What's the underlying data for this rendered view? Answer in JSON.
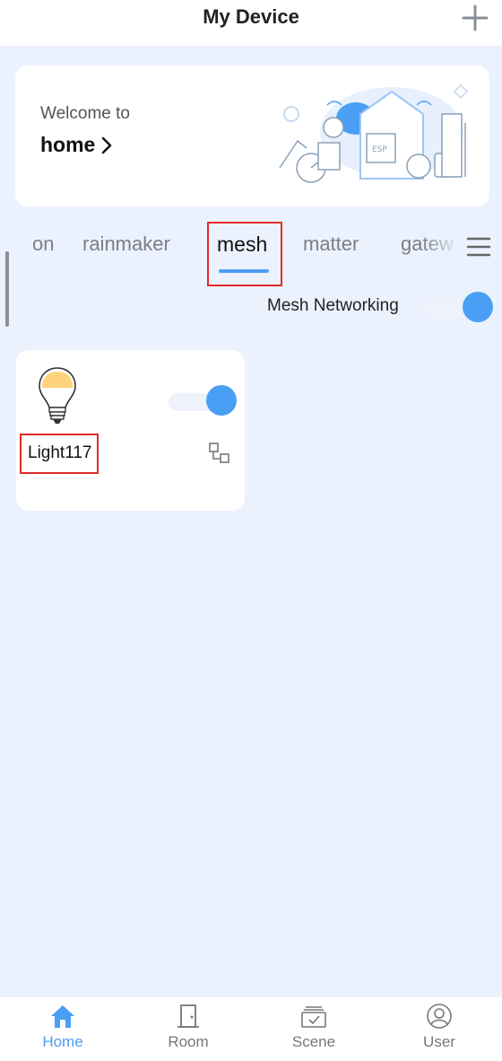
{
  "header": {
    "title": "My Device",
    "add_icon": "plus-icon"
  },
  "welcome": {
    "greeting": "Welcome to",
    "home_name": "home",
    "chevron_icon": "chevron-right-icon",
    "illustration": "smart-home-illustration"
  },
  "tabs": {
    "items": [
      {
        "label": "on"
      },
      {
        "label": "rainmaker"
      },
      {
        "label": "mesh"
      },
      {
        "label": "matter"
      },
      {
        "label": "gatew"
      }
    ],
    "active": "mesh",
    "menu_icon": "hamburger-menu-icon"
  },
  "mesh_networking": {
    "label": "Mesh Networking",
    "enabled": true
  },
  "devices": [
    {
      "name": "Light117",
      "icon": "light-bulb-icon",
      "power_on": true,
      "group_icon": "group-icon"
    }
  ],
  "bottom_nav": {
    "items": [
      {
        "label": "Home",
        "icon": "home-icon",
        "active": true
      },
      {
        "label": "Room",
        "icon": "door-icon",
        "active": false
      },
      {
        "label": "Scene",
        "icon": "scene-icon",
        "active": false
      },
      {
        "label": "User",
        "icon": "user-icon",
        "active": false
      }
    ]
  },
  "colors": {
    "accent": "#4A9FF5",
    "background": "#EBF2FD",
    "highlight": "#E32A2A"
  }
}
